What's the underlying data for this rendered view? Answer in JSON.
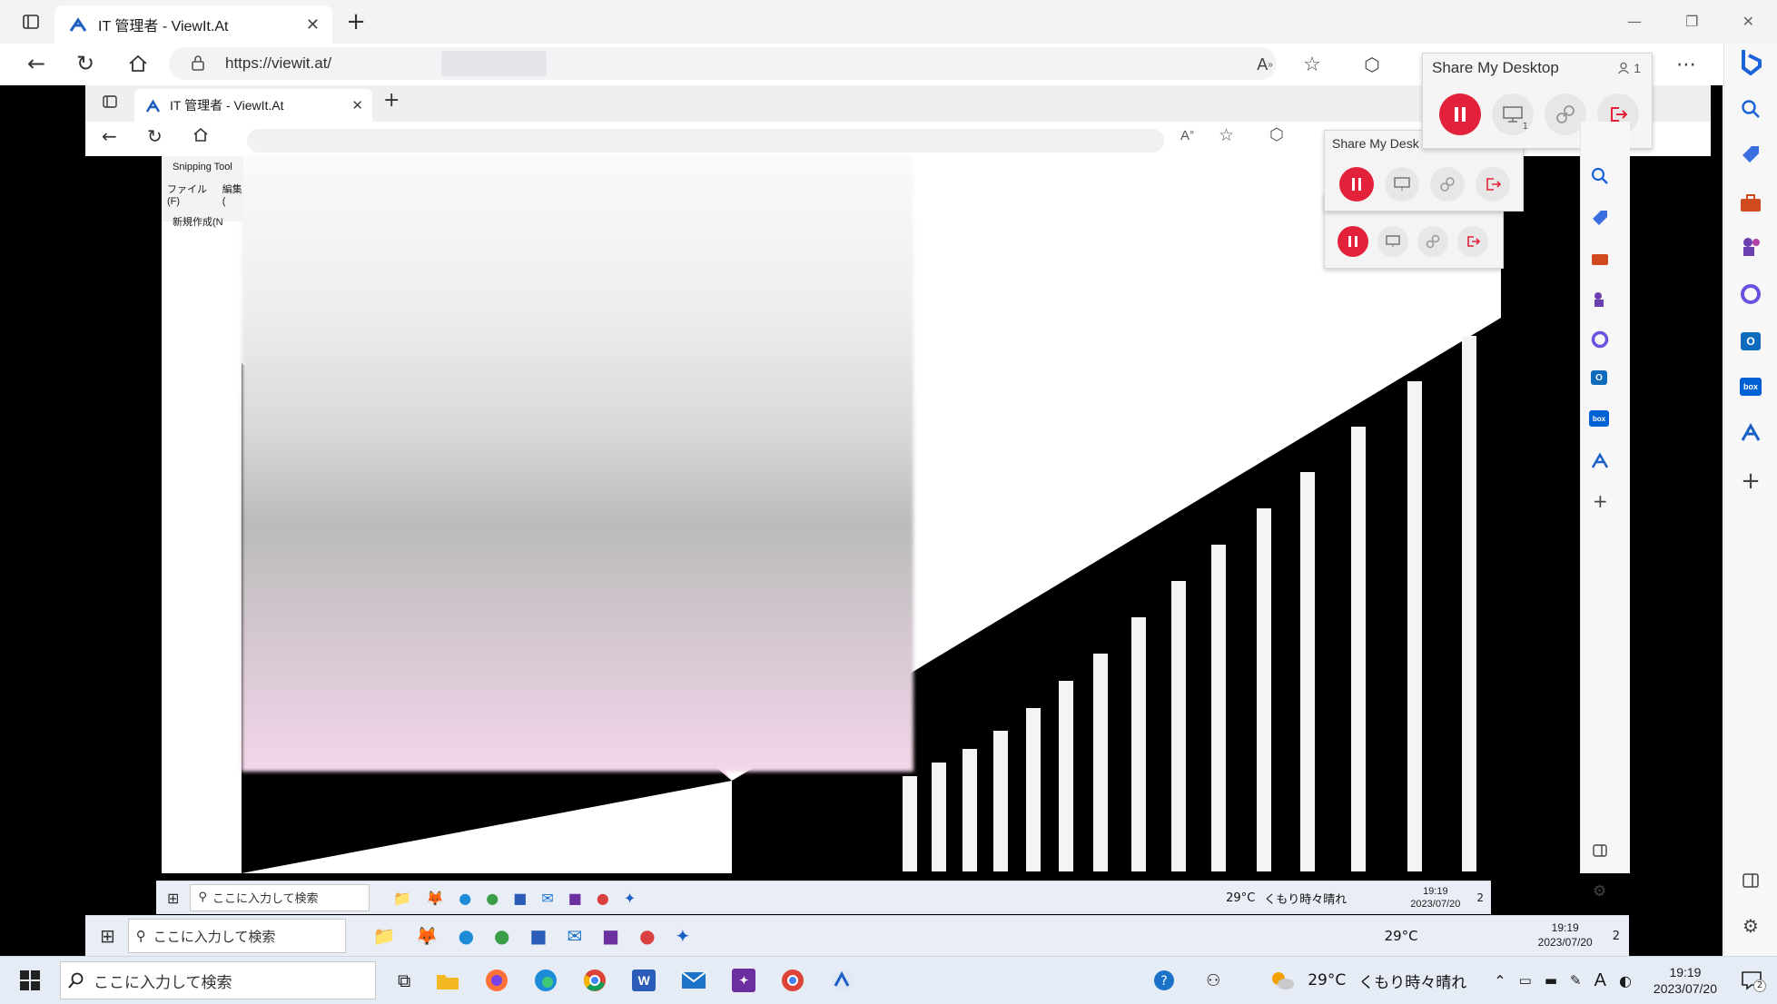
{
  "browser": {
    "tab_title": "IT 管理者 - ViewIt.At",
    "url": "https://viewit.at/"
  },
  "inner_browser": {
    "tab_title": "IT 管理者 - ViewIt.At",
    "snipping": {
      "title": "Snipping Tool",
      "menu_file": "ファイル(F)",
      "menu_edit": "編集(",
      "new_label": "新規作成(N"
    }
  },
  "share_panel": {
    "title": "Share My Desktop",
    "participants": "1",
    "display_count": "1",
    "colors": {
      "pause": "#e4213a",
      "leave": "#e4213a"
    },
    "icons": [
      "pause-icon",
      "monitor-icon",
      "link-icon",
      "leave-icon"
    ]
  },
  "share_panel_echo": {
    "title": "Share My Desk"
  },
  "taskbar": {
    "search_placeholder": "ここに入力して検索",
    "temperature": "29°C",
    "weather": "くもり時々晴れ",
    "time": "19:19",
    "date": "2023/07/20",
    "notifications": "2"
  },
  "inner_taskbar_1": {
    "search_placeholder": "ここに入力して検索",
    "temperature": "29°C",
    "time": "19:19",
    "date": "2023/07/20",
    "notifications": "2"
  },
  "inner_taskbar_2": {
    "search_placeholder": "ここに入力して検索",
    "temperature": "29°C",
    "weather": "くもり時々晴れ",
    "time": "19:19",
    "date": "2023/07/20",
    "notifications": "2"
  },
  "sidebar": {
    "items": [
      "bing-icon",
      "search-icon",
      "tag-icon",
      "toolbox-icon",
      "games-icon",
      "office-icon",
      "outlook-icon",
      "box-icon",
      "viewit-icon",
      "add-icon"
    ],
    "box_label": "box"
  }
}
